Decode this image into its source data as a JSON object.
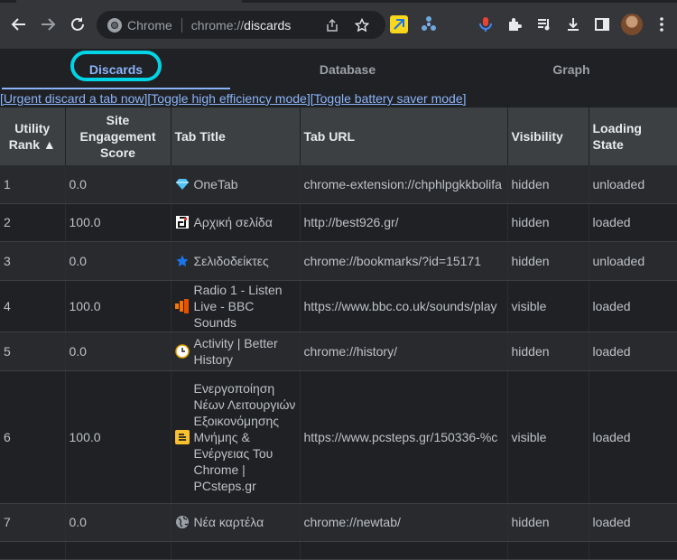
{
  "browser": {
    "site_chip": "Chrome",
    "url_prefix": "chrome://",
    "url_host": "discards"
  },
  "page_tabs": [
    "Discards",
    "Database",
    "Graph"
  ],
  "actions": [
    "[Urgent discard a tab now]",
    "[Toggle high efficiency mode]",
    "[Toggle battery saver mode]"
  ],
  "table": {
    "headers": [
      "Utility Rank ▲",
      "Site Engagement Score",
      "Tab Title",
      "Tab URL",
      "Visibility",
      "Loading State"
    ],
    "rows": [
      {
        "rank": "1",
        "score": "0.0",
        "title": "OneTab",
        "url": "chrome-extension://chphlpgkkbolifa",
        "visibility": "hidden",
        "state": "unloaded",
        "icon": "gem-icon"
      },
      {
        "rank": "2",
        "score": "100.0",
        "title": "Αρχική σελίδα",
        "url": "http://best926.gr/",
        "visibility": "hidden",
        "state": "loaded",
        "icon": "site-logo-icon"
      },
      {
        "rank": "3",
        "score": "0.0",
        "title": "Σελιδοδείκτες",
        "url": "chrome://bookmarks/?id=15171",
        "visibility": "hidden",
        "state": "unloaded",
        "icon": "star-icon"
      },
      {
        "rank": "4",
        "score": "100.0",
        "title": "Radio 1 - Listen Live - BBC Sounds",
        "url": "https://www.bbc.co.uk/sounds/play",
        "visibility": "visible",
        "state": "loaded",
        "icon": "bbc-sounds-icon"
      },
      {
        "rank": "5",
        "score": "0.0",
        "title": "Activity | Better History",
        "url": "chrome://history/",
        "visibility": "hidden",
        "state": "loaded",
        "icon": "clock-icon"
      },
      {
        "rank": "6",
        "score": "100.0",
        "title": "Ενεργοποίηση Νέων Λειτουργιών Εξοικονόμησης Μνήμης & Ενέργειας Του Chrome | PCsteps.gr",
        "url": "https://www.pcsteps.gr/150336-%c",
        "visibility": "visible",
        "state": "loaded",
        "icon": "pcsteps-icon"
      },
      {
        "rank": "7",
        "score": "0.0",
        "title": "Νέα καρτέλα",
        "url": "chrome://newtab/",
        "visibility": "hidden",
        "state": "loaded",
        "icon": "globe-icon"
      }
    ]
  }
}
